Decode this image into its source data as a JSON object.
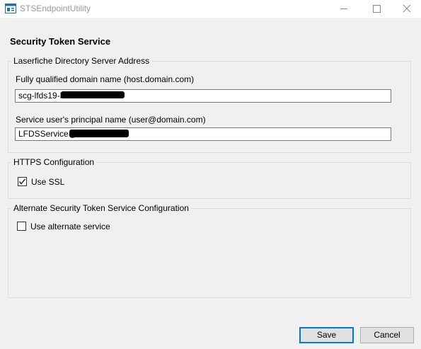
{
  "window": {
    "title": "STSEndpointUtility",
    "controls": [
      "minimize-icon",
      "maximize-icon",
      "close-icon"
    ]
  },
  "page": {
    "heading": "Security Token Service"
  },
  "directory_group": {
    "legend": "Laserfiche Directory Server Address",
    "fqdn_label": "Fully qualified domain name (host.domain.com)",
    "fqdn_value": "scg-lfds19-br",
    "upn_label": "Service user's principal name (user@domain.com)",
    "upn_value": "LFDSService@"
  },
  "https_group": {
    "legend": "HTTPS Configuration",
    "use_ssl_label": "Use SSL",
    "use_ssl_checked": true
  },
  "alternate_group": {
    "legend": "Alternate Security Token Service Configuration",
    "use_alternate_label": "Use alternate service",
    "use_alternate_checked": false
  },
  "buttons": {
    "save": "Save",
    "cancel": "Cancel"
  }
}
